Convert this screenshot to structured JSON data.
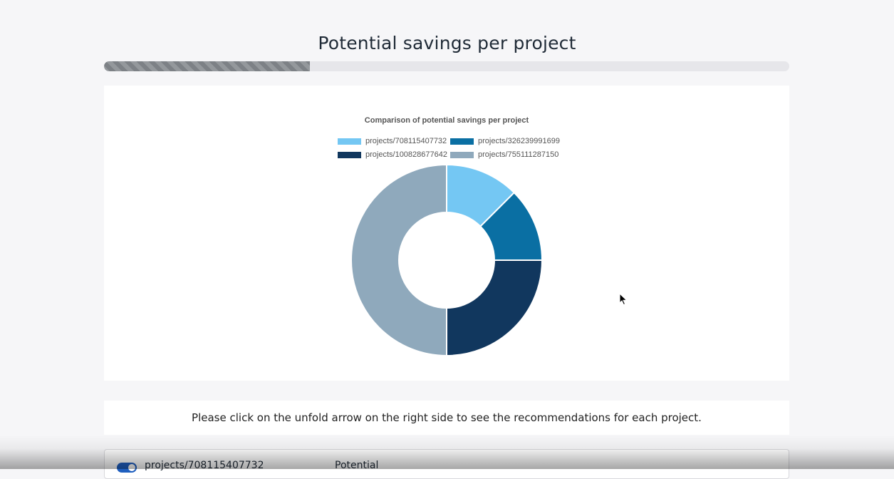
{
  "page": {
    "title": "Potential savings per project",
    "progress_fraction": 0.3
  },
  "chart_data": {
    "type": "pie",
    "variant": "doughnut",
    "title": "Comparison of potential savings per project",
    "legend_position": "top",
    "series": [
      {
        "name": "projects/708115407732",
        "value": 12.5,
        "color": "#74c7f3"
      },
      {
        "name": "projects/326239991699",
        "value": 12.5,
        "color": "#0a6fa3"
      },
      {
        "name": "projects/100828677642",
        "value": 25,
        "color": "#11375e"
      },
      {
        "name": "projects/755111287150",
        "value": 50,
        "color": "#8fa9bc"
      }
    ]
  },
  "info": {
    "text": "Please click on the unfold arrow on the right side to see the recommendations for each project."
  },
  "project_row": {
    "name": "projects/708115407732",
    "potential_label": "Potential",
    "toggle_on": true
  }
}
